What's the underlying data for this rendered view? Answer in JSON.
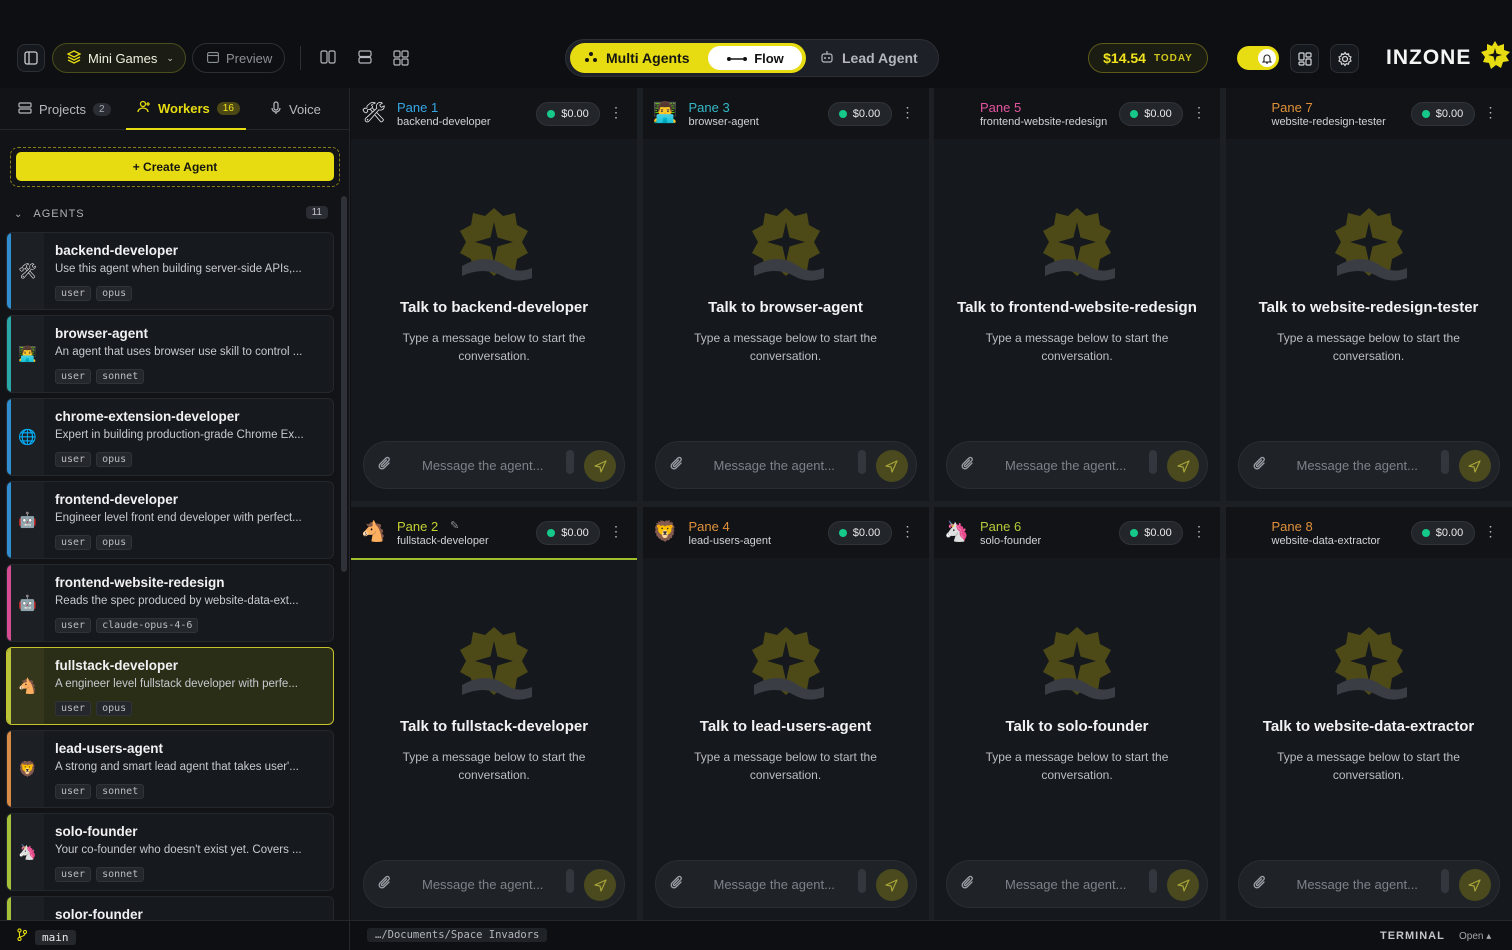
{
  "header": {
    "sidebar_toggle_icon": "sidebar-toggle-icon",
    "project_selector": {
      "label": "Mini Games",
      "icon": "layers-icon"
    },
    "preview_label": "Preview",
    "layout_icons": [
      "columns-layout-icon",
      "rows-layout-icon",
      "grid-layout-icon"
    ],
    "modes": {
      "multi_agents": "Multi Agents",
      "flow": "Flow",
      "lead_agent": "Lead Agent",
      "active": "Multi Agents"
    },
    "cost": {
      "amount": "$14.54",
      "period": "TODAY"
    },
    "notifications_toggle": true,
    "brand": "INZONE",
    "accent_color": "#e7dc12"
  },
  "sidebar": {
    "tabs": [
      {
        "label": "Projects",
        "count": "2"
      },
      {
        "label": "Workers",
        "count": "16",
        "active": true
      },
      {
        "label": "Voice"
      }
    ],
    "create_button": "+ Create Agent",
    "agents_section": {
      "label": "AGENTS",
      "count": "11"
    },
    "agents": [
      {
        "name": "backend-developer",
        "description": "Use this agent when building server-side APIs,...",
        "tags": [
          "user",
          "opus"
        ],
        "emoji": "🛠",
        "color": "#2f8fd1"
      },
      {
        "name": "browser-agent",
        "description": "An agent that uses browser use skill to control ...",
        "tags": [
          "user",
          "sonnet"
        ],
        "emoji": "👨‍💻",
        "color": "#2aa7a7"
      },
      {
        "name": "chrome-extension-developer",
        "description": "Expert in building production-grade Chrome Ex...",
        "tags": [
          "user",
          "opus"
        ],
        "emoji": "🌐",
        "color": "#2f8fd1"
      },
      {
        "name": "frontend-developer",
        "description": "Engineer level front end developer with perfect...",
        "tags": [
          "user",
          "opus"
        ],
        "emoji": "🤖",
        "color": "#2f8fd1"
      },
      {
        "name": "frontend-website-redesign",
        "description": "Reads the spec produced by website-data-ext...",
        "tags": [
          "user",
          "claude-opus-4-6"
        ],
        "emoji": "🤖",
        "color": "#d64c93"
      },
      {
        "name": "fullstack-developer",
        "description": "A engineer level fullstack developer with perfe...",
        "tags": [
          "user",
          "opus"
        ],
        "emoji": "🐴",
        "color": "#b9c23a",
        "active": true
      },
      {
        "name": "lead-users-agent",
        "description": "A strong and smart lead agent that takes user'...",
        "tags": [
          "user",
          "sonnet"
        ],
        "emoji": "🦁",
        "color": "#d98a45"
      },
      {
        "name": "solo-founder",
        "description": "Your co-founder who doesn't exist yet. Covers ...",
        "tags": [
          "user",
          "sonnet"
        ],
        "emoji": "🦄",
        "color": "#a6c23a"
      },
      {
        "name": "solor-founder",
        "description": "",
        "tags": [],
        "emoji": "",
        "color": "#a6c23a"
      }
    ]
  },
  "panes": [
    {
      "title": "Pane 1",
      "agent": "backend-developer",
      "cost": "$0.00",
      "emoji": "🛠",
      "color": "#35a7e6",
      "talk": "Talk to backend-developer"
    },
    {
      "title": "Pane 3",
      "agent": "browser-agent",
      "cost": "$0.00",
      "emoji": "👨‍💻",
      "color": "#35b9c7",
      "talk": "Talk to browser-agent"
    },
    {
      "title": "Pane 5",
      "agent": "frontend-website-redesign",
      "cost": "$0.00",
      "emoji": "",
      "color": "#e3559f",
      "talk": "Talk to frontend-website-redesign"
    },
    {
      "title": "Pane 7",
      "agent": "website-redesign-tester",
      "cost": "$0.00",
      "emoji": "",
      "color": "#e0913a",
      "talk": "Talk to website-redesign-tester"
    },
    {
      "title": "Pane 2",
      "agent": "fullstack-developer",
      "cost": "$0.00",
      "emoji": "🐴",
      "color": "#c3cf33",
      "talk": "Talk to fullstack-developer",
      "selected": true
    },
    {
      "title": "Pane 4",
      "agent": "lead-users-agent",
      "cost": "$0.00",
      "emoji": "🦁",
      "color": "#e0913a",
      "talk": "Talk to lead-users-agent"
    },
    {
      "title": "Pane 6",
      "agent": "solo-founder",
      "cost": "$0.00",
      "emoji": "🦄",
      "color": "#b6c93a",
      "talk": "Talk to solo-founder"
    },
    {
      "title": "Pane 8",
      "agent": "website-data-extractor",
      "cost": "$0.00",
      "emoji": "",
      "color": "#e0913a",
      "talk": "Talk to website-data-extractor"
    }
  ],
  "pane_common": {
    "hint": "Type a message below to start the conversation.",
    "input_placeholder": "Message the agent..."
  },
  "footer": {
    "branch": "main",
    "path": "…/Documents/Space Invadors",
    "terminal_label": "TERMINAL",
    "open_label": "Open ▴"
  }
}
